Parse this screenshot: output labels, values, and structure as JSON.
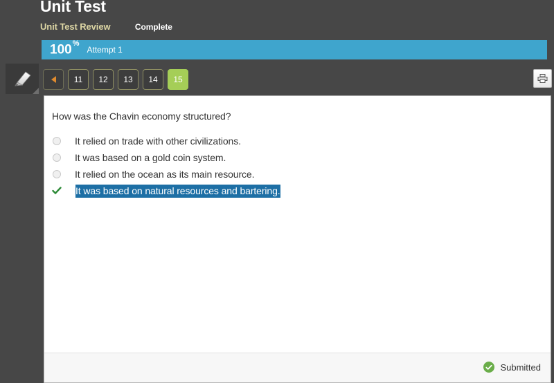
{
  "header": {
    "title": "Unit Test",
    "subtitle": "Unit Test Review",
    "status": "Complete",
    "accent_tan": "#ddd6a4"
  },
  "score": {
    "value": "100",
    "percent_symbol": "%",
    "attempt": "Attempt 1",
    "bar_color": "#3fa5cd"
  },
  "toolbar": {
    "pencil_tool_name": "pencil-icon",
    "print_button_name": "print-icon"
  },
  "pager": {
    "prev_label": "",
    "items": [
      {
        "label": "11",
        "active": false
      },
      {
        "label": "12",
        "active": false
      },
      {
        "label": "13",
        "active": false
      },
      {
        "label": "14",
        "active": false
      },
      {
        "label": "15",
        "active": true
      }
    ],
    "active_color": "#a5ce57",
    "border_color": "#8f8f62"
  },
  "question": {
    "text": "How was the Chavin economy structured?",
    "options": [
      {
        "text": "It relied on trade with other civilizations.",
        "state": "unselected"
      },
      {
        "text": "It was based on a gold coin system.",
        "state": "unselected"
      },
      {
        "text": "It relied on the ocean as its main resource.",
        "state": "unselected"
      },
      {
        "text": "It was based on natural resources and bartering.",
        "state": "correct"
      }
    ],
    "highlight_color": "#1d6fa5"
  },
  "footer": {
    "submitted_label": "Submitted",
    "badge_color": "#6aad49"
  }
}
